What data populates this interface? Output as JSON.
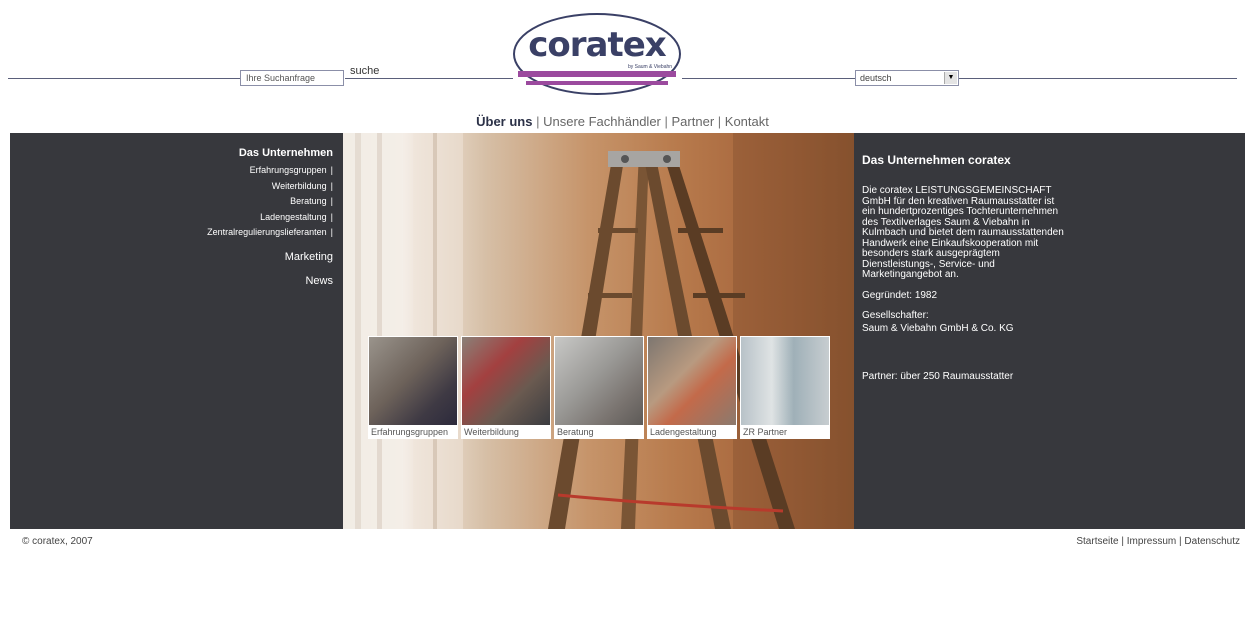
{
  "header": {
    "search_placeholder": "Ihre Suchanfrage",
    "search_button": "suche",
    "logo_text": "coratex",
    "logo_tagline": "by Saum & Viebahn",
    "language": "deutsch"
  },
  "topnav": [
    {
      "label": "Über uns"
    },
    {
      "label": "Unsere Fachhändler"
    },
    {
      "label": "Partner"
    },
    {
      "label": "Kontakt"
    }
  ],
  "sidebar": {
    "heading": "Das Unternehmen",
    "sub_items": [
      {
        "label": "Erfahrungsgruppen"
      },
      {
        "label": "Weiterbildung"
      },
      {
        "label": "Beratung"
      },
      {
        "label": "Ladengestaltung"
      },
      {
        "label": "Zentralregulierungslieferanten"
      }
    ],
    "marketing": "Marketing",
    "news": "News"
  },
  "thumbnails": [
    {
      "caption": "Erfahrungsgruppen"
    },
    {
      "caption": "Weiterbildung"
    },
    {
      "caption": "Beratung"
    },
    {
      "caption": "Ladengestaltung"
    },
    {
      "caption": "ZR Partner"
    }
  ],
  "content": {
    "title": "Das Unternehmen coratex",
    "body": "Die coratex LEISTUNGSGEMEINSCHAFT GmbH für den kreativen Raumausstatter ist ein hundertprozentiges Tochterunternehmen des Textilverlages Saum & Viebahn in Kulmbach und bietet dem raumausstattenden Handwerk eine Einkaufskooperation mit besonders stark ausgeprägtem Dienstleistungs-, Service- und Marketingangebot an.",
    "founded": "Gegründet: 1982",
    "shareholder_label": "Gesellschafter:",
    "shareholder": "Saum & Viebahn GmbH & Co. KG",
    "partners": "Partner: über 250 Raumausstatter"
  },
  "footer": {
    "copyright": "© coratex, 2007",
    "links": [
      {
        "label": "Startseite"
      },
      {
        "label": "Impressum"
      },
      {
        "label": "Datenschutz"
      }
    ]
  },
  "colors": {
    "panel": "#37383d",
    "logo_purple": "#9b4a9e",
    "logo_navy": "#3a4066"
  }
}
